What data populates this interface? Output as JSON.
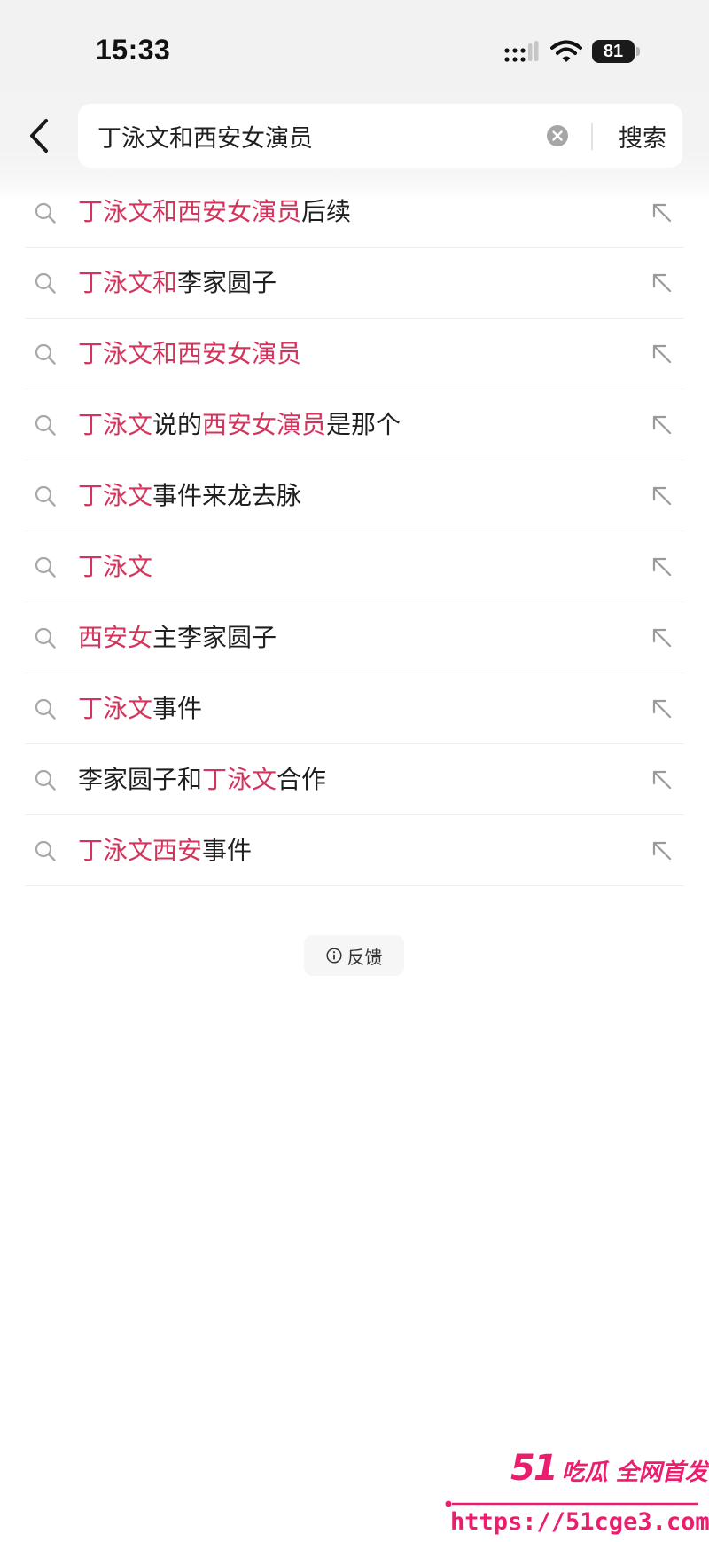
{
  "status_bar": {
    "time": "15:33",
    "battery": "81"
  },
  "search": {
    "query": "丁泳文和西安女演员",
    "submit_label": "搜索"
  },
  "suggestions": [
    {
      "parts": [
        {
          "t": "丁泳文和西安女演员",
          "hl": true
        },
        {
          "t": "后续",
          "hl": false
        }
      ]
    },
    {
      "parts": [
        {
          "t": "丁泳文和",
          "hl": true
        },
        {
          "t": "李家圆子",
          "hl": false
        }
      ]
    },
    {
      "parts": [
        {
          "t": "丁泳文和西安女演员",
          "hl": true
        }
      ]
    },
    {
      "parts": [
        {
          "t": "丁泳文",
          "hl": true
        },
        {
          "t": "说的",
          "hl": false
        },
        {
          "t": "西安女演员",
          "hl": true
        },
        {
          "t": "是那个",
          "hl": false
        }
      ]
    },
    {
      "parts": [
        {
          "t": "丁泳文",
          "hl": true
        },
        {
          "t": "事件来龙去脉",
          "hl": false
        }
      ]
    },
    {
      "parts": [
        {
          "t": "丁泳文",
          "hl": true
        }
      ]
    },
    {
      "parts": [
        {
          "t": "西安女",
          "hl": true
        },
        {
          "t": "主李家圆子",
          "hl": false
        }
      ]
    },
    {
      "parts": [
        {
          "t": "丁泳文",
          "hl": true
        },
        {
          "t": "事件",
          "hl": false
        }
      ]
    },
    {
      "parts": [
        {
          "t": "李家圆子和",
          "hl": false
        },
        {
          "t": "丁泳文",
          "hl": true
        },
        {
          "t": "合作",
          "hl": false
        }
      ]
    },
    {
      "parts": [
        {
          "t": "丁泳文西安",
          "hl": true
        },
        {
          "t": "事件",
          "hl": false
        }
      ]
    }
  ],
  "feedback_label": "反馈",
  "watermark": {
    "number": "51",
    "brand": "吃瓜 全网首发",
    "url": "https://51cge3.com"
  },
  "colors": {
    "highlight": "#d4345b",
    "watermark": "#ec1c6e"
  }
}
